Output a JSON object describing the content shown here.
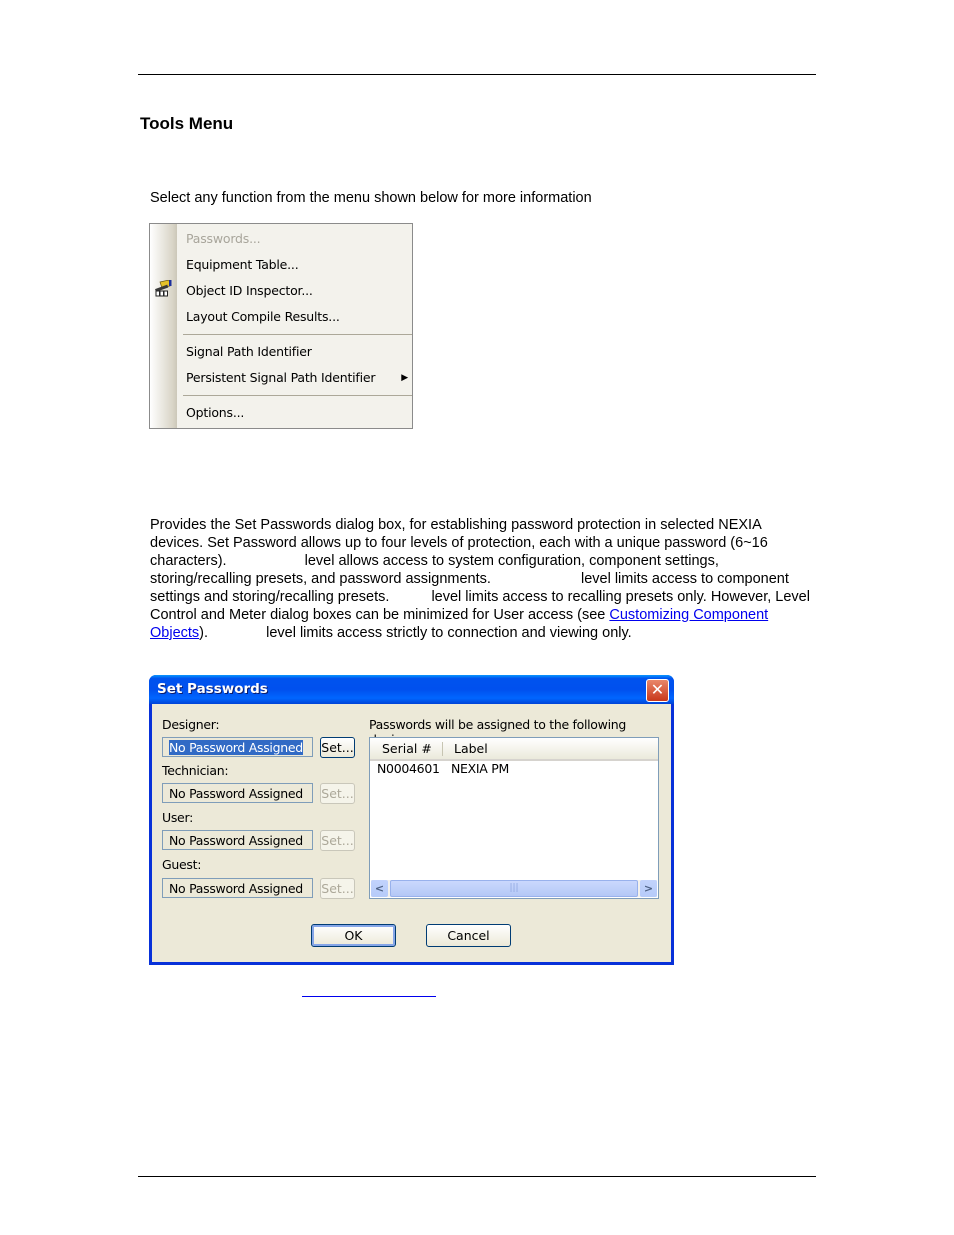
{
  "page": {
    "heading": "Tools Menu",
    "intro": "Select any function from the menu shown below for more information",
    "paragraph": {
      "part1": "Provides the Set Passwords dialog box, for establishing password protection in selected NEXIA devices. Set Password allows up to four levels of protection, each with a unique password (6~16 characters).",
      "part2": "level allows access to system configuration, component settings, storing/recalling presets, and password assignments.",
      "part3": "level limits access to component settings and storing/recalling presets.",
      "part4": "level limits access to recalling presets only. However, Level Control and Meter dialog boxes can be minimized for User access (see",
      "link": "Customizing Component Objects",
      "part5": ").",
      "part6": "level limits access strictly to connection and viewing only."
    }
  },
  "tools_menu": {
    "items": [
      {
        "label": "Passwords...",
        "disabled": true
      },
      {
        "label": "Equipment Table...",
        "disabled": false
      },
      {
        "label": "Object ID Inspector...",
        "disabled": false,
        "icon": "inspector-icon"
      },
      {
        "label": "Layout Compile Results...",
        "disabled": false
      },
      {
        "label": "Signal Path Identifier",
        "disabled": false
      },
      {
        "label": "Persistent Signal Path Identifier",
        "disabled": false,
        "submenu": true
      },
      {
        "label": "Options...",
        "disabled": false
      }
    ],
    "submenu_arrow": "▶"
  },
  "dialog": {
    "title": "Set Passwords",
    "close_glyph": "✕",
    "levels": [
      {
        "label": "Designer:",
        "value": "No Password Assigned",
        "selected": true,
        "set_label": "Set...",
        "set_enabled": true
      },
      {
        "label": "Technician:",
        "value": "No Password Assigned",
        "selected": false,
        "set_label": "Set...",
        "set_enabled": false
      },
      {
        "label": "User:",
        "value": "No Password Assigned",
        "selected": false,
        "set_label": "Set...",
        "set_enabled": false
      },
      {
        "label": "Guest:",
        "value": "No Password Assigned",
        "selected": false,
        "set_label": "Set...",
        "set_enabled": false
      }
    ],
    "devices_label": "Passwords will be assigned to the following devices:",
    "columns": [
      "Serial #",
      "Label"
    ],
    "rows": [
      {
        "serial": "N0004601",
        "label": "NEXIA PM"
      }
    ],
    "scroll_left": "<",
    "scroll_right": ">",
    "scroll_grip": "|||",
    "ok_label": "OK",
    "cancel_label": "Cancel"
  }
}
